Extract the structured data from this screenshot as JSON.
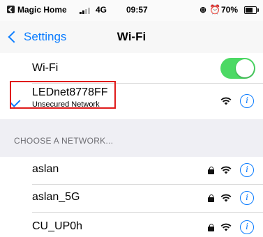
{
  "status_bar": {
    "carrier": "Magic Home",
    "network_type": "4G",
    "time": "09:57",
    "battery_percent": "70%",
    "battery_level": 0.7,
    "icons": [
      "back-to-app-icon",
      "signal-bars-icon",
      "rotation-lock-icon",
      "alarm-icon",
      "battery-icon"
    ]
  },
  "nav": {
    "back_label": "Settings",
    "title": "Wi-Fi"
  },
  "wifi_toggle": {
    "label": "Wi-Fi",
    "on": true,
    "color": "#4cd964"
  },
  "connected": {
    "ssid": "LEDnet8778FF",
    "subtitle": "Unsecured Network",
    "icons": [
      "checkmark-icon",
      "wifi-signal-icon",
      "info-icon"
    ]
  },
  "section_header": "CHOOSE A NETWORK...",
  "networks": [
    {
      "ssid": "aslan",
      "secured": true
    },
    {
      "ssid": "aslan_5G",
      "secured": true
    },
    {
      "ssid": "CU_UP0h",
      "secured": true
    }
  ],
  "colors": {
    "accent": "#0a7cff",
    "highlight": "#e01b1b"
  },
  "info_glyph": "i"
}
